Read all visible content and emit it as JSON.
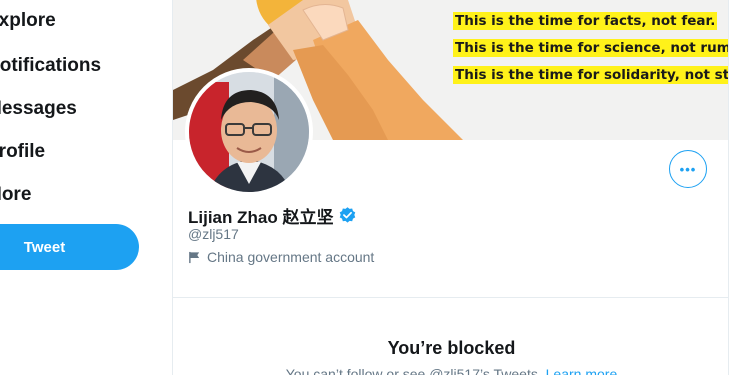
{
  "sidebar": {
    "items": [
      {
        "label": "Explore"
      },
      {
        "label": "Notifications"
      },
      {
        "label": "Messages"
      },
      {
        "label": "Profile"
      },
      {
        "label": "More"
      }
    ],
    "tweet_button": "Tweet"
  },
  "banner": {
    "lines": [
      "This is the time for facts, not fear.",
      "This is the time for science, not rumors.",
      "This is the time for solidarity, not stigma."
    ]
  },
  "profile": {
    "display_name": "Lijian Zhao 赵立坚",
    "handle": "@zlj517",
    "account_label": "China government account",
    "more_button": "•••"
  },
  "blocked": {
    "title": "You’re blocked",
    "message": "You can’t follow or see @zlj517’s Tweets.",
    "link": "Learn more"
  },
  "colors": {
    "accent": "#1da1f2",
    "text_primary": "#14171a",
    "text_secondary": "#657786",
    "highlight": "#fff21a"
  }
}
